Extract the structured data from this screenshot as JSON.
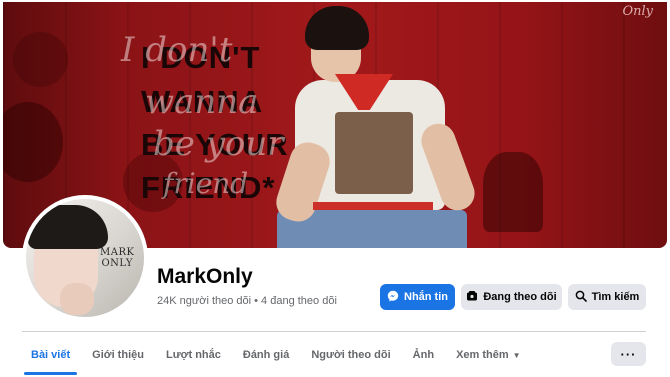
{
  "cover": {
    "headline_lines": [
      "I DON'T",
      "WANNA",
      "BE YOUR",
      "FRIEND*"
    ],
    "script_lines": [
      "I don't",
      "wanna",
      "be your",
      "friend"
    ],
    "watermark": "Only"
  },
  "avatar": {
    "text_line1": "MARK",
    "text_line2": "ONLY"
  },
  "profile": {
    "name": "MarkOnly",
    "stats": "24K người theo dõi • 4 đang theo dõi"
  },
  "actions": {
    "message_label": "Nhắn tin",
    "following_label": "Đang theo dõi",
    "search_label": "Tìm kiếm",
    "more_label": "···"
  },
  "tabs": [
    {
      "label": "Bài viết",
      "active": true
    },
    {
      "label": "Giới thiệu"
    },
    {
      "label": "Lượt nhắc"
    },
    {
      "label": "Đánh giá"
    },
    {
      "label": "Người theo dõi"
    },
    {
      "label": "Ảnh"
    },
    {
      "label": "Xem thêm",
      "dropdown": true
    }
  ],
  "colors": {
    "accent": "#1b74e4",
    "cover_red": "#a2191b",
    "button_gray": "#e4e6eb"
  },
  "icons": {
    "message": "messenger-icon",
    "following": "following-icon",
    "search": "search-icon",
    "dropdown": "caret-down-icon"
  }
}
